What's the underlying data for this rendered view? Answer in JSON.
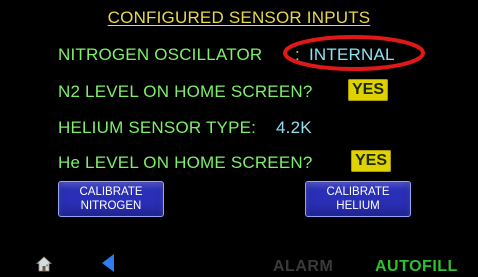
{
  "screen": {
    "title": "CONFIGURED SENSOR INPUTS",
    "nitrogen_oscillator": {
      "label": "NITROGEN OSCILLATOR",
      "separator": ":",
      "value": "INTERNAL"
    },
    "n2_level_home": {
      "label": "N2 LEVEL ON HOME SCREEN?",
      "value": "YES"
    },
    "helium_sensor_type": {
      "label": "HELIUM SENSOR TYPE:",
      "value": "4.2K"
    },
    "he_level_home": {
      "label": "He LEVEL ON HOME SCREEN?",
      "value": "YES"
    },
    "buttons": {
      "calibrate_nitrogen": [
        "CALIBRATE",
        "NITROGEN"
      ],
      "calibrate_helium": [
        "CALIBRATE",
        "HELIUM"
      ]
    },
    "footer": {
      "alarm": "ALARM",
      "autofill": "AUTOFILL"
    }
  },
  "icons": {
    "home": "home-icon",
    "back": "back-arrow-icon"
  },
  "colors": {
    "background": "#000000",
    "title": "#e8d84a",
    "label": "#7ef06a",
    "value": "#8fe0f0",
    "badge": "#e0d100",
    "button": "#2a2fb8",
    "highlight_ellipse": "#e01818",
    "alarm_inactive": "#3a3a3a",
    "autofill": "#2ec02e",
    "back_arrow": "#2f7cf0"
  }
}
